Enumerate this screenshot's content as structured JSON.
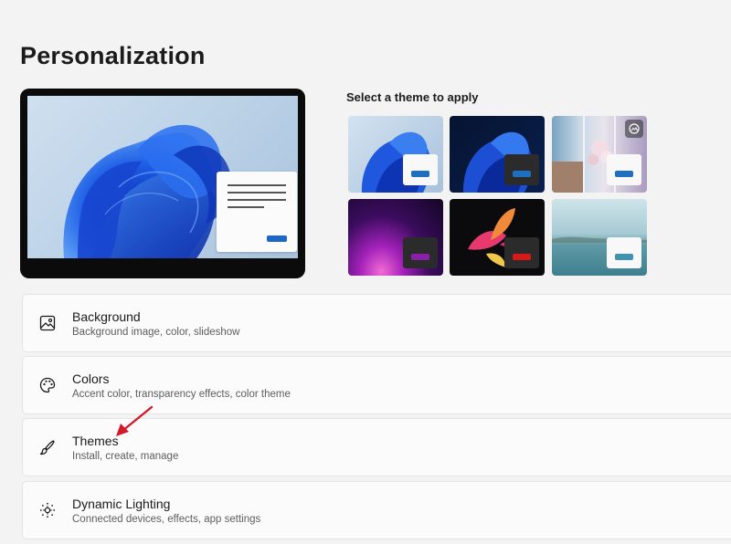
{
  "page": {
    "title": "Personalization"
  },
  "themes_section": {
    "label": "Select a theme to apply"
  },
  "themes": [
    {
      "name": "theme-windows-light",
      "accent": "#1e6fc0"
    },
    {
      "name": "theme-windows-dark",
      "accent": "#1e6fc0"
    },
    {
      "name": "theme-glow",
      "accent": "#1e6fc0"
    },
    {
      "name": "theme-captured-motion",
      "accent": "#8a1fa8"
    },
    {
      "name": "theme-flow",
      "accent": "#d61a1a"
    },
    {
      "name": "theme-sunrise",
      "accent": "#3f93ae"
    }
  ],
  "settings": [
    {
      "icon": "image-icon",
      "title": "Background",
      "subtitle": "Background image, color, slideshow"
    },
    {
      "icon": "palette-icon",
      "title": "Colors",
      "subtitle": "Accent color, transparency effects, color theme"
    },
    {
      "icon": "brush-icon",
      "title": "Themes",
      "subtitle": "Install, create, manage"
    },
    {
      "icon": "dynamic-lighting-icon",
      "title": "Dynamic Lighting",
      "subtitle": "Connected devices, effects, app settings"
    }
  ]
}
